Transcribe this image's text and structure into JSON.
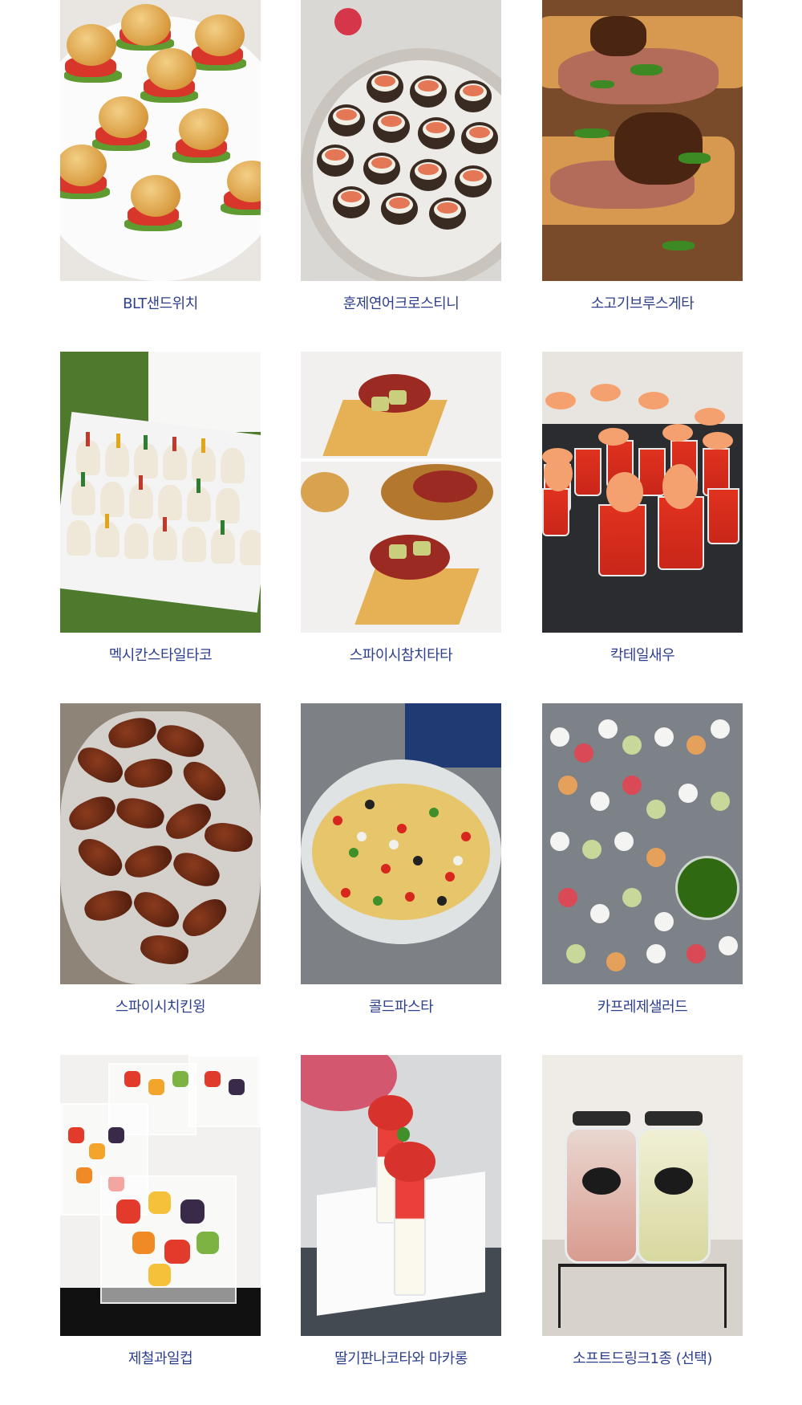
{
  "menu": {
    "items": [
      {
        "name": "BLT샌드위치"
      },
      {
        "name": "훈제연어크로스티니"
      },
      {
        "name": "소고기브루스게타"
      },
      {
        "name": "멕시칸스타일타코"
      },
      {
        "name": "스파이시참치타타"
      },
      {
        "name": "칵테일새우"
      },
      {
        "name": "스파이시치킨윙"
      },
      {
        "name": "콜드파스타"
      },
      {
        "name": "카프레제샐러드"
      },
      {
        "name": "제철과일컵"
      },
      {
        "name": "딸기판나코타와 마카롱"
      },
      {
        "name": "소프트드링크1종 (선택)"
      }
    ]
  },
  "colors": {
    "caption_text": "#2e3f8c",
    "background": "#ffffff"
  }
}
